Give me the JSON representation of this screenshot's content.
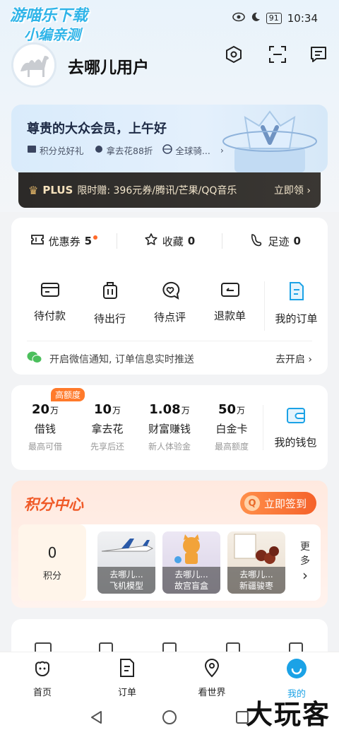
{
  "status": {
    "watermark_line1": "游喵乐下载",
    "watermark_line2": "小编亲测",
    "battery": "91",
    "time": "10:34"
  },
  "header": {
    "username": "去哪儿用户"
  },
  "member": {
    "title": "尊贵的大众会员，上午好",
    "items": [
      "积分兑好礼",
      "拿去花88折",
      "全球骑..."
    ],
    "plus_label": "PLUS",
    "plus_text": "限时赠: 396元券/腾讯/芒果/QQ音乐",
    "plus_action": "立即领 ›"
  },
  "quick": [
    {
      "label": "优惠券",
      "count": "5"
    },
    {
      "label": "收藏",
      "count": "0"
    },
    {
      "label": "足迹",
      "count": "0"
    }
  ],
  "orders": [
    "待付款",
    "待出行",
    "待点评",
    "退款单"
  ],
  "my_orders": "我的订单",
  "wechat": {
    "text": "开启微信通知, 订单信息实时推送",
    "action": "去开启 ›"
  },
  "finance": {
    "badge": "高额度",
    "items": [
      {
        "value": "20",
        "unit": "万",
        "label": "借钱",
        "sub": "最高可借"
      },
      {
        "value": "10",
        "unit": "万",
        "label": "拿去花",
        "sub": "先享后还"
      },
      {
        "value": "1.08",
        "unit": "万",
        "label": "财富赚钱",
        "sub": "新人体验金"
      },
      {
        "value": "50",
        "unit": "万",
        "label": "白金卡",
        "sub": "最高额度"
      }
    ],
    "wallet": "我的钱包"
  },
  "points": {
    "title": "积分中心",
    "signin": "立即签到",
    "count": "0",
    "unit": "积分",
    "gifts": [
      {
        "line1": "去哪儿...",
        "line2": "飞机模型"
      },
      {
        "line1": "去哪儿...",
        "line2": "故宫盲盒"
      },
      {
        "line1": "去哪儿...",
        "line2": "新疆骏枣"
      }
    ],
    "more": "更多"
  },
  "tabs": [
    "首页",
    "订单",
    "看世界",
    "我的"
  ],
  "brand_watermark": "大玩客",
  "colors": {
    "accent": "#1ba2e6",
    "orange": "#f05a28"
  }
}
